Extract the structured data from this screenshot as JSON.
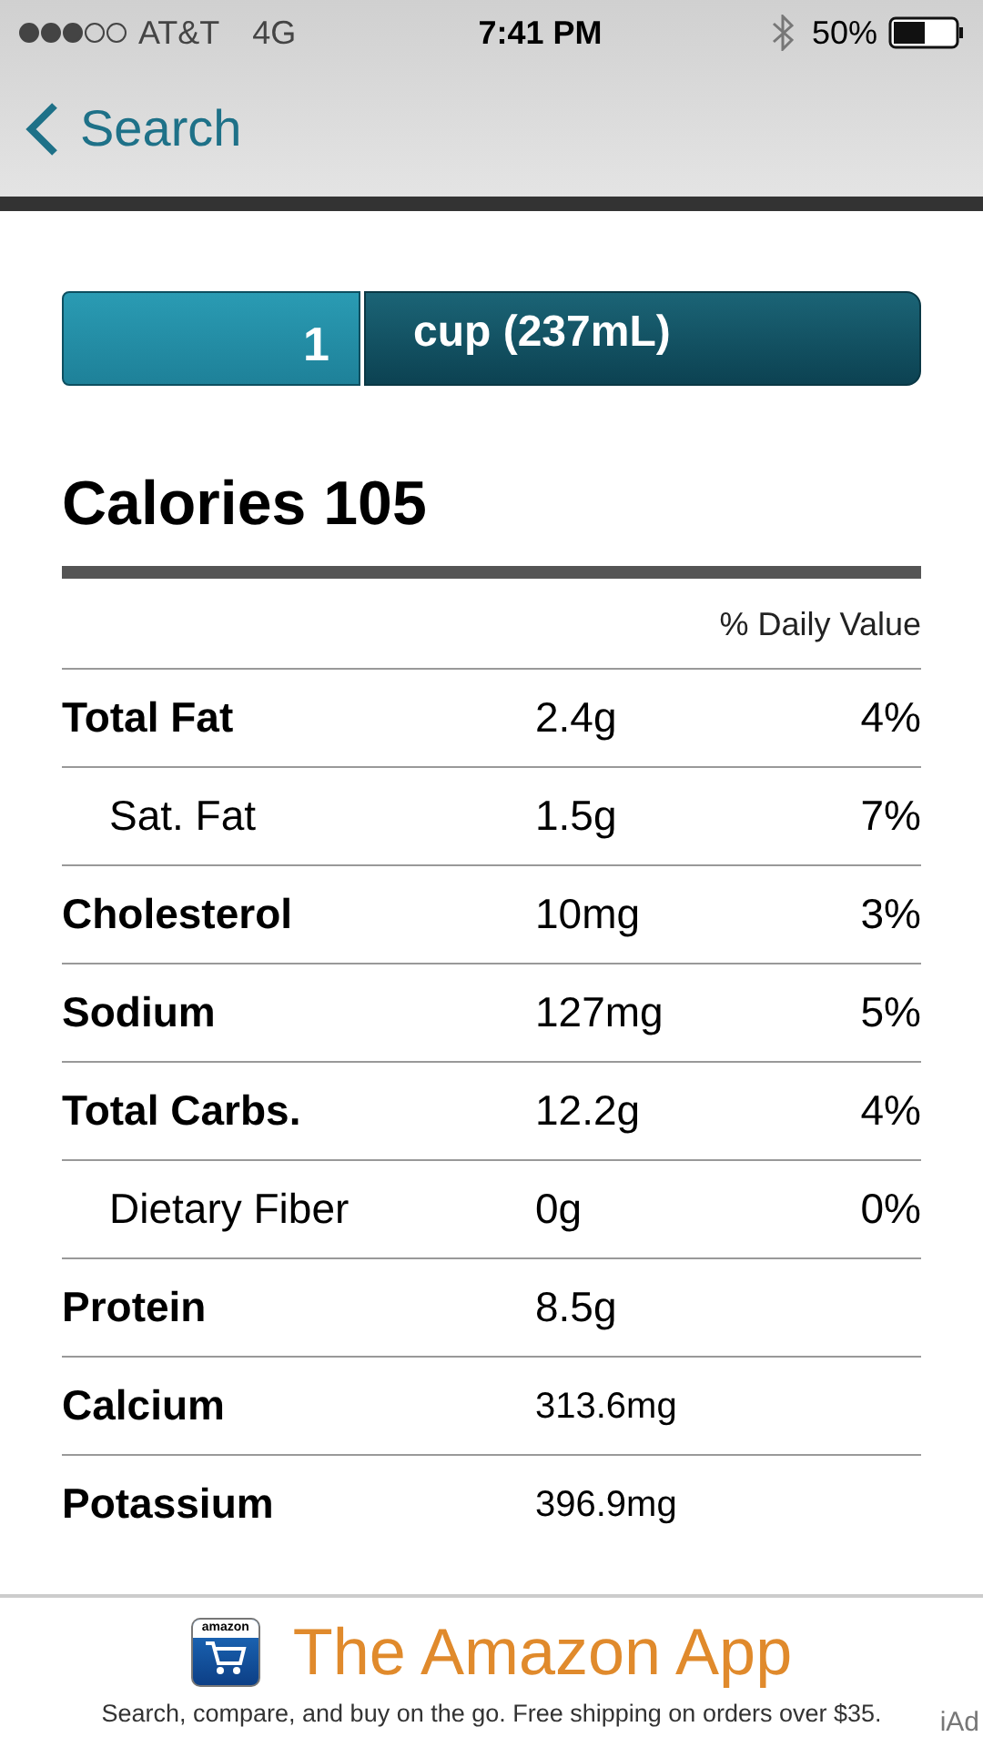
{
  "status_bar": {
    "carrier": "AT&T",
    "network": "4G",
    "time": "7:41 PM",
    "battery": "50%"
  },
  "nav": {
    "back_label": "Search"
  },
  "serving": {
    "quantity": "1",
    "unit": "cup (237mL)"
  },
  "calories": "Calories 105",
  "daily_value_header": "% Daily Value",
  "rows": [
    {
      "kind": "main",
      "name": "Total Fat",
      "amount": "2.4g",
      "percent": "4%"
    },
    {
      "kind": "sub",
      "name": "Sat. Fat",
      "amount": "1.5g",
      "percent": "7%"
    },
    {
      "kind": "main",
      "name": "Cholesterol",
      "amount": "10mg",
      "percent": "3%"
    },
    {
      "kind": "main",
      "name": "Sodium",
      "amount": "127mg",
      "percent": "5%"
    },
    {
      "kind": "main",
      "name": "Total Carbs.",
      "amount": "12.2g",
      "percent": "4%"
    },
    {
      "kind": "sub",
      "name": "Dietary Fiber",
      "amount": "0g",
      "percent": "0%"
    },
    {
      "kind": "main",
      "name": "Protein",
      "amount": "8.5g"
    },
    {
      "kind": "mineral",
      "name": "Calcium",
      "amount": "313.6mg"
    },
    {
      "kind": "mineral",
      "name": "Potassium",
      "amount": "396.9mg"
    }
  ],
  "ad": {
    "icon_text": "amazon",
    "title": "The Amazon App",
    "text": "Search, compare, and buy on the go. Free shipping on orders over $35.",
    "badge": "iAd"
  }
}
